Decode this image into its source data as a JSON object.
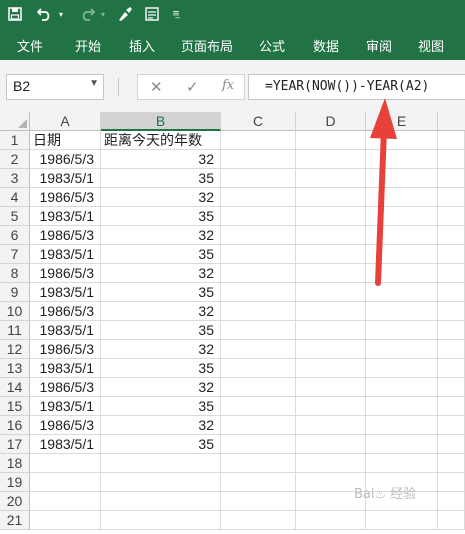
{
  "quick_access": {
    "icons": [
      "save-icon",
      "undo-icon",
      "redo-icon",
      "format-painter-icon",
      "form-icon",
      "customize-icon"
    ]
  },
  "ribbon": {
    "tabs": [
      "文件",
      "开始",
      "插入",
      "页面布局",
      "公式",
      "数据",
      "审阅",
      "视图"
    ]
  },
  "formula_bar": {
    "name_box": "B2",
    "cancel_symbol": "✕",
    "enter_symbol": "✓",
    "fx_symbol": "fx",
    "formula": "=YEAR(NOW())-YEAR(A2)"
  },
  "sheet": {
    "columns": [
      "A",
      "B",
      "C",
      "D",
      "E"
    ],
    "selected_column": "B",
    "row_numbers": [
      "1",
      "2",
      "3",
      "4",
      "5",
      "6",
      "7",
      "8",
      "9",
      "10",
      "11",
      "12",
      "13",
      "14",
      "15",
      "16",
      "17",
      "18",
      "19",
      "20",
      "21"
    ],
    "header": [
      "日期",
      "距离今天的年数"
    ],
    "rows": [
      [
        "1986/5/3",
        "32"
      ],
      [
        "1983/5/1",
        "35"
      ],
      [
        "1986/5/3",
        "32"
      ],
      [
        "1983/5/1",
        "35"
      ],
      [
        "1986/5/3",
        "32"
      ],
      [
        "1983/5/1",
        "35"
      ],
      [
        "1986/5/3",
        "32"
      ],
      [
        "1983/5/1",
        "35"
      ],
      [
        "1986/5/3",
        "32"
      ],
      [
        "1983/5/1",
        "35"
      ],
      [
        "1986/5/3",
        "32"
      ],
      [
        "1983/5/1",
        "35"
      ],
      [
        "1986/5/3",
        "32"
      ],
      [
        "1983/5/1",
        "35"
      ],
      [
        "1986/5/3",
        "32"
      ],
      [
        "1983/5/1",
        "35"
      ]
    ]
  },
  "annotation": {
    "arrow_color": "#e8403a"
  },
  "colors": {
    "accent": "#217346"
  }
}
